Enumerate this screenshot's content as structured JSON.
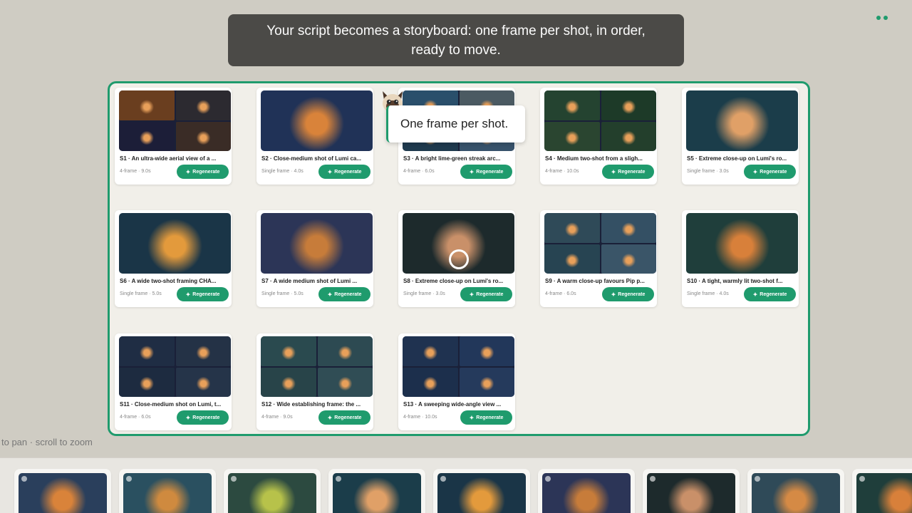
{
  "banner": {
    "text": "Your script becomes a storyboard: one frame per shot, in order, ready to move."
  },
  "tooltip": {
    "text": "One frame per shot."
  },
  "pan_hint": "to pan · scroll to zoom",
  "regenerate_label": "Regenerate",
  "accent_color": "#1f9b6d",
  "shots": [
    {
      "title": "S1 · An ultra-wide aerial view of a ...",
      "meta": "4-frame · 9.0s",
      "thumb": "quad",
      "palette": [
        "#6a3e1f",
        "#2c2a30",
        "#1c1e38",
        "#3a2c26"
      ]
    },
    {
      "title": "S2 · Close-medium shot of Lumi ca...",
      "meta": "Single frame · 4.0s",
      "thumb": "single",
      "palette": [
        "#203257",
        "#d9833a"
      ]
    },
    {
      "title": "S3 · A bright lime-green streak arc...",
      "meta": "4-frame · 6.0s",
      "thumb": "quad",
      "palette": [
        "#2a4f6b",
        "#4b5a62",
        "#1f3a4e",
        "#37526b"
      ]
    },
    {
      "title": "S4 · Medium two-shot from a sligh...",
      "meta": "4-frame · 10.0s",
      "thumb": "quad",
      "palette": [
        "#244330",
        "#1d3a28",
        "#2a4530",
        "#233f2c"
      ]
    },
    {
      "title": "S5 · Extreme close-up on Lumi's ro...",
      "meta": "Single frame · 3.0s",
      "thumb": "single",
      "palette": [
        "#1b3d4a",
        "#e0a067"
      ]
    },
    {
      "title": "S6 · A wide two-shot framing CHA...",
      "meta": "Single frame · 5.0s",
      "thumb": "single",
      "palette": [
        "#1a3547",
        "#e39a3c"
      ]
    },
    {
      "title": "S7 · A wide medium shot of Lumi ...",
      "meta": "Single frame · 5.0s",
      "thumb": "single",
      "palette": [
        "#2c3557",
        "#c77c3a"
      ]
    },
    {
      "title": "S8 · Extreme close-up on Lumi's ro...",
      "meta": "Single frame · 3.0s",
      "thumb": "single",
      "palette": [
        "#1d2a2c",
        "#c99069"
      ]
    },
    {
      "title": "S9 · A warm close-up favours Pip p...",
      "meta": "4-frame · 6.0s",
      "thumb": "quad",
      "palette": [
        "#2f4a58",
        "#345064",
        "#274452",
        "#3a5568"
      ]
    },
    {
      "title": "S10 · A tight, warmly lit two-shot f...",
      "meta": "Single frame · 4.0s",
      "thumb": "single",
      "palette": [
        "#1f3e3b",
        "#d8803a"
      ]
    },
    {
      "title": "S11 · Close-medium shot on Lumi, t...",
      "meta": "4-frame · 6.0s",
      "thumb": "quad",
      "palette": [
        "#1f2d44",
        "#243246",
        "#1d2b40",
        "#253449"
      ]
    },
    {
      "title": "S12 · Wide establishing frame: the ...",
      "meta": "4-frame · 9.0s",
      "thumb": "quad",
      "palette": [
        "#2a4a4f",
        "#2d4a52",
        "#284449",
        "#304d55"
      ]
    },
    {
      "title": "S13 · A sweeping wide-angle view ...",
      "meta": "4-frame · 10.0s",
      "thumb": "quad",
      "palette": [
        "#1f3250",
        "#22375a",
        "#1c2f4c",
        "#253a5c"
      ]
    }
  ],
  "filmstrip": [
    {
      "palette": [
        "#2a3f5c",
        "#d9833a"
      ]
    },
    {
      "palette": [
        "#2a5060",
        "#cf8a3f"
      ]
    },
    {
      "palette": [
        "#2c4a40",
        "#b7c24a"
      ]
    },
    {
      "palette": [
        "#1b3d4a",
        "#e0a067"
      ]
    },
    {
      "palette": [
        "#1a3547",
        "#e39a3c"
      ]
    },
    {
      "palette": [
        "#2c3557",
        "#c77c3a"
      ]
    },
    {
      "palette": [
        "#1d2a2c",
        "#c99069"
      ]
    },
    {
      "palette": [
        "#2f4a58",
        "#d58a45"
      ]
    },
    {
      "palette": [
        "#1f3e3b",
        "#d8803a"
      ]
    }
  ]
}
